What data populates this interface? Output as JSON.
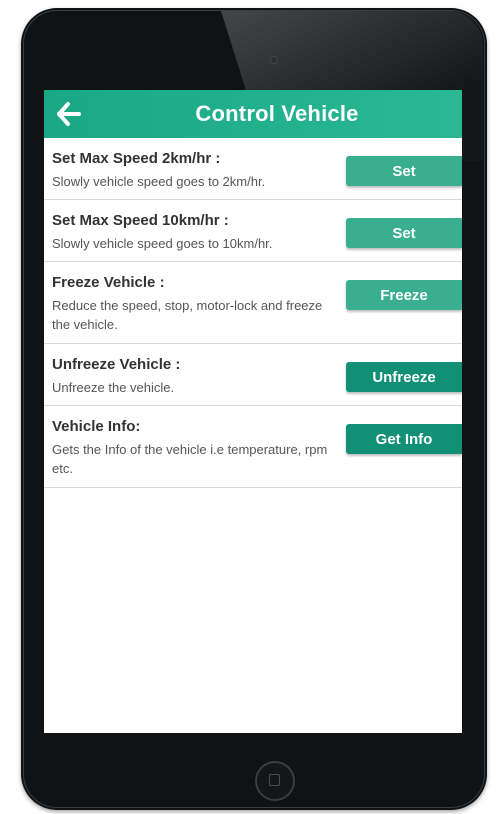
{
  "app": {
    "title": "Control Vehicle",
    "accent_color": "#1fae8c",
    "back_icon": "arrow-left-icon"
  },
  "controls": [
    {
      "title": "Set Max Speed 2km/hr :",
      "description": "Slowly vehicle speed goes to 2km/hr.",
      "button": "Set"
    },
    {
      "title": "Set Max Speed 10km/hr :",
      "description": "Slowly vehicle speed goes to 10km/hr.",
      "button": "Set"
    },
    {
      "title": "Freeze Vehicle :",
      "description": "Reduce the speed, stop, motor-lock and freeze the vehicle.",
      "button": "Freeze"
    },
    {
      "title": "Unfreeze Vehicle :",
      "description": "Unfreeze the vehicle.",
      "button": "Unfreeze"
    },
    {
      "title": "Vehicle Info:",
      "description": "Gets the Info of the vehicle i.e temperature, rpm etc.",
      "button": "Get Info"
    }
  ]
}
